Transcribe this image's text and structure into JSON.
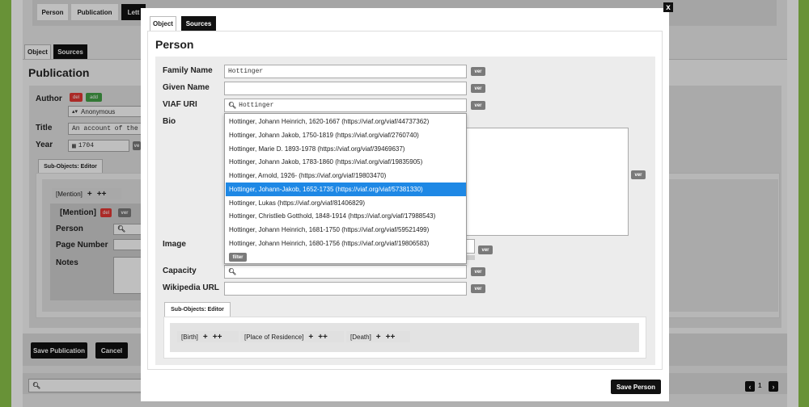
{
  "background": {
    "top_tabs": [
      "Person",
      "Publication",
      "Lett"
    ],
    "object_tabs": {
      "object": "Object",
      "sources": "Sources"
    },
    "section_title": "Publication",
    "author_label": "Author",
    "del_label": "del",
    "add_label": "add",
    "author_value": "Anonymous",
    "title_label": "Title",
    "title_value": "An account of the",
    "year_label": "Year",
    "year_value": "1704",
    "ver_label": "ve",
    "subobjects_tab": "Sub-Objects: Editor",
    "mention_chip": "[Mention]",
    "mention_heading": "[Mention]",
    "mention_del": "del",
    "mention_ver": "ver",
    "person_label": "Person",
    "page_number_label": "Page Number",
    "notes_label": "Notes",
    "save_publication": "Save Publication",
    "cancel": "Cancel",
    "pager_page": "1"
  },
  "modal": {
    "close_label": "x",
    "tabs": {
      "object": "Object",
      "sources": "Sources"
    },
    "title": "Person",
    "family_name_label": "Family Name",
    "family_name_value": "Hottinger",
    "given_name_label": "Given Name",
    "given_name_value": "",
    "viaf_label": "VIAF URI",
    "viaf_value": "Hottinger",
    "bio_label": "Bio",
    "image_label": "Image",
    "capacity_label": "Capacity",
    "wikipedia_label": "Wikipedia URL",
    "ver_label": "ver",
    "subobjects_tab": "Sub-Objects: Editor",
    "chips": [
      "[Birth]",
      "[Place of Residence]",
      "[Death]"
    ],
    "save_person": "Save Person"
  },
  "dropdown": {
    "items": [
      "Hottinger, Johann Heinrich, 1620-1667 (https://viaf.org/viaf/44737362)",
      "Hottinger, Johann Jakob, 1750-1819 (https://viaf.org/viaf/2760740)",
      "Hottinger, Marie D. 1893-1978 (https://viaf.org/viaf/39469637)",
      "Hottinger, Johann Jakob, 1783-1860 (https://viaf.org/viaf/19835905)",
      "Hottinger, Arnold, 1926- (https://viaf.org/viaf/19803470)",
      "Hottinger, Johann-Jakob, 1652-1735 (https://viaf.org/viaf/57381330)",
      "Hottinger, Lukas (https://viaf.org/viaf/81406829)",
      "Hottinger, Christlieb Gotthold, 1848-1914 (https://viaf.org/viaf/17988543)",
      "Hottinger, Johann Heinrich, 1681-1750 (https://viaf.org/viaf/59521499)",
      "Hottinger, Johann Heinrich, 1680-1756 (https://viaf.org/viaf/19806583)"
    ],
    "selected_index": 5,
    "filter_label": "filter"
  },
  "colors": {
    "page_border": "#8bc34a",
    "dark_button": "#111111",
    "ver_button": "#7a7a7a",
    "del_button": "#e53935",
    "add_button": "#43a047",
    "selected_row": "#1e88e5"
  },
  "icons": [
    "search-icon",
    "calendar-icon",
    "sort-icon",
    "plus-icon",
    "double-plus-icon",
    "chevron-left-icon",
    "chevron-right-icon",
    "close-icon"
  ]
}
